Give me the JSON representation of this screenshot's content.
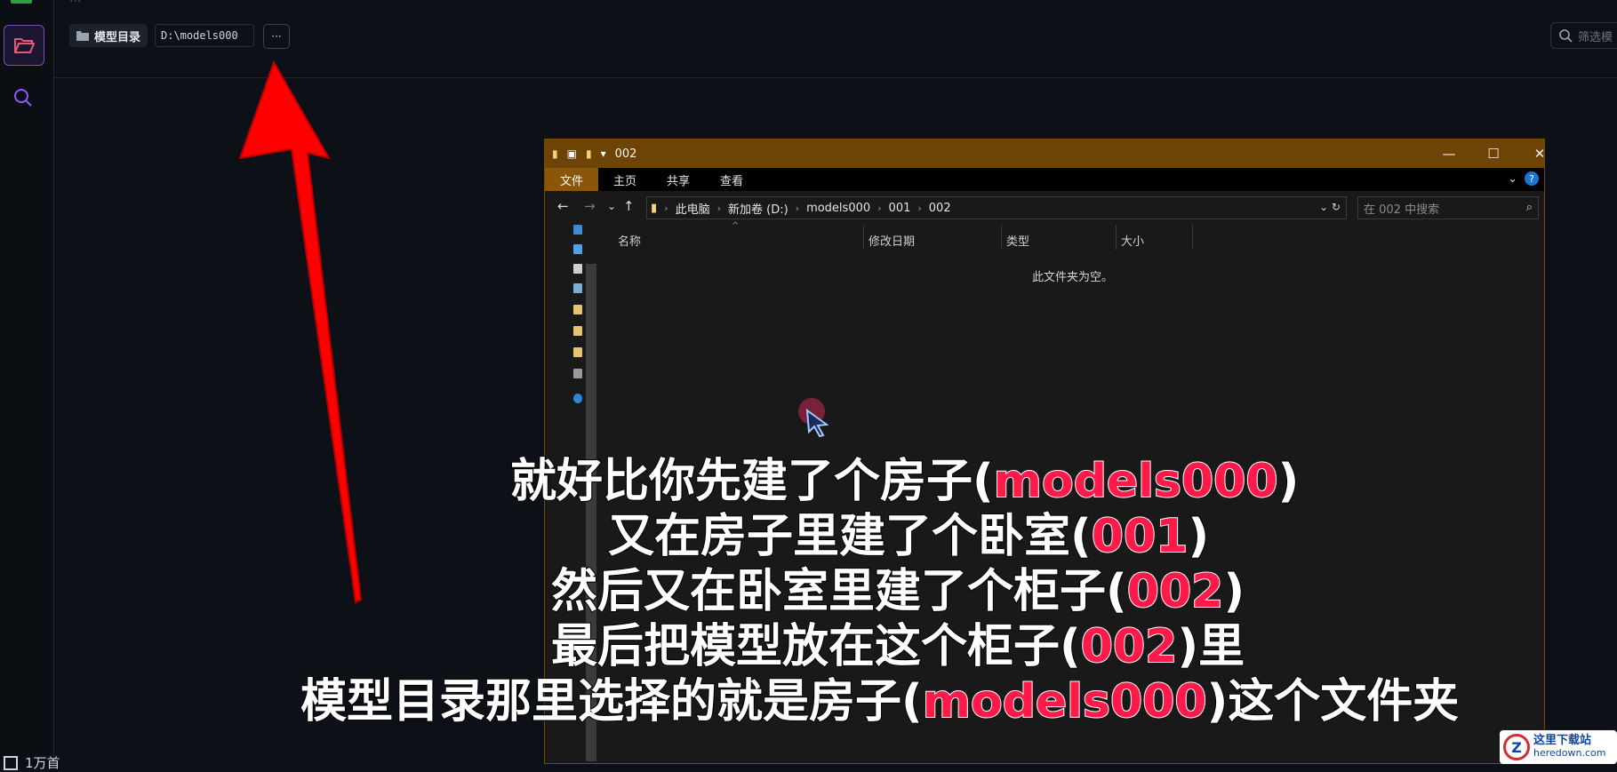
{
  "app": {
    "top_crumb": "...",
    "model_dir_label": "模型目录",
    "model_dir_value": "D:\\models000",
    "more_label": "···",
    "filter_placeholder": "筛选模",
    "bottom_status": "1万首"
  },
  "explorer": {
    "title": "002",
    "ribbon_tabs": [
      "文件",
      "主页",
      "共享",
      "查看"
    ],
    "address": [
      "此电脑",
      "新加卷 (D:)",
      "models000",
      "001",
      "002"
    ],
    "search_placeholder": "在 002 中搜索",
    "columns": [
      "名称",
      "修改日期",
      "类型",
      "大小"
    ],
    "empty_message": "此文件夹为空。",
    "help_label": "?"
  },
  "subtitles": {
    "l1_a": "就好比你先建了个房子(",
    "l1_hl": "models000",
    "l1_b": ")",
    "l2_a": "又在房子里建了个卧室(",
    "l2_hl": "001",
    "l2_b": ")",
    "l3_a": "然后又在卧室里建了个柜子(",
    "l3_hl": "002",
    "l3_b": ")",
    "l4_a": "最后把模型放在这个柜子(",
    "l4_hl": "002",
    "l4_b": ")里",
    "l5_a": "模型目录那里选择的就是房子(",
    "l5_hl": "models000",
    "l5_b": ")这个文件夹"
  },
  "watermark": {
    "cn": "这里下载站",
    "en": "heredown.com"
  },
  "colors": {
    "accent_red": "#ff1a4a",
    "explorer_title": "#6e4306",
    "arrow": "#ff0000"
  }
}
